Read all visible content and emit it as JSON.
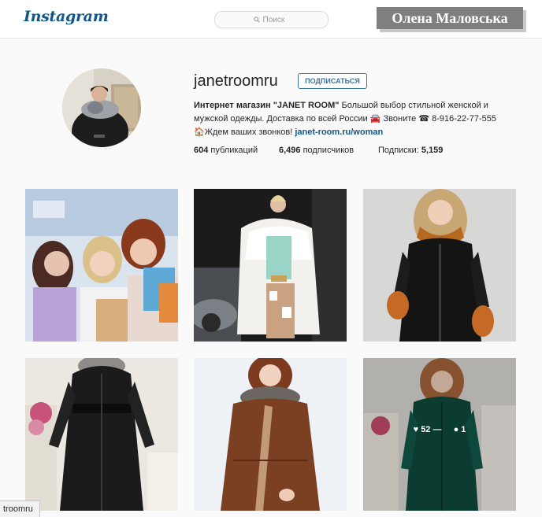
{
  "header": {
    "logo_text": "Instagram",
    "search_placeholder": "Поиск",
    "watermark": "Олена Маловська"
  },
  "profile": {
    "username": "janetroomru",
    "follow_label": "ПОДПИСАТЬСЯ",
    "bio_name": "Интернет магазин \"JANET ROOM\"",
    "bio_text_1": "Большой выбор стильной женской и мужской одежды. Доставка по всей России 🚘 Звоните ☎ 8-916-22-77-555🏠Ждем ваших звонков!",
    "website": "janet-room.ru/woman"
  },
  "stats": {
    "posts_count": "604",
    "posts_label": "публикаций",
    "followers_count": "6,496",
    "followers_label": "подписчиков",
    "following_label": "Подписки:",
    "following_count": "5,159"
  },
  "posts": [
    {
      "label": "post-shopping-women"
    },
    {
      "label": "post-white-fur-coat"
    },
    {
      "label": "post-black-leather-jacket-fox-fur"
    },
    {
      "label": "post-black-long-down-coat"
    },
    {
      "label": "post-brown-coat-fur-collar"
    },
    {
      "label": "post-green-down-coat",
      "likes": "52",
      "comments": "1",
      "likes_suffix": "—"
    }
  ],
  "status_bar": {
    "text": "troomru"
  },
  "colors": {
    "brand_blue": "#125688",
    "follow_blue": "#3f729b",
    "background": "#fafafa"
  }
}
